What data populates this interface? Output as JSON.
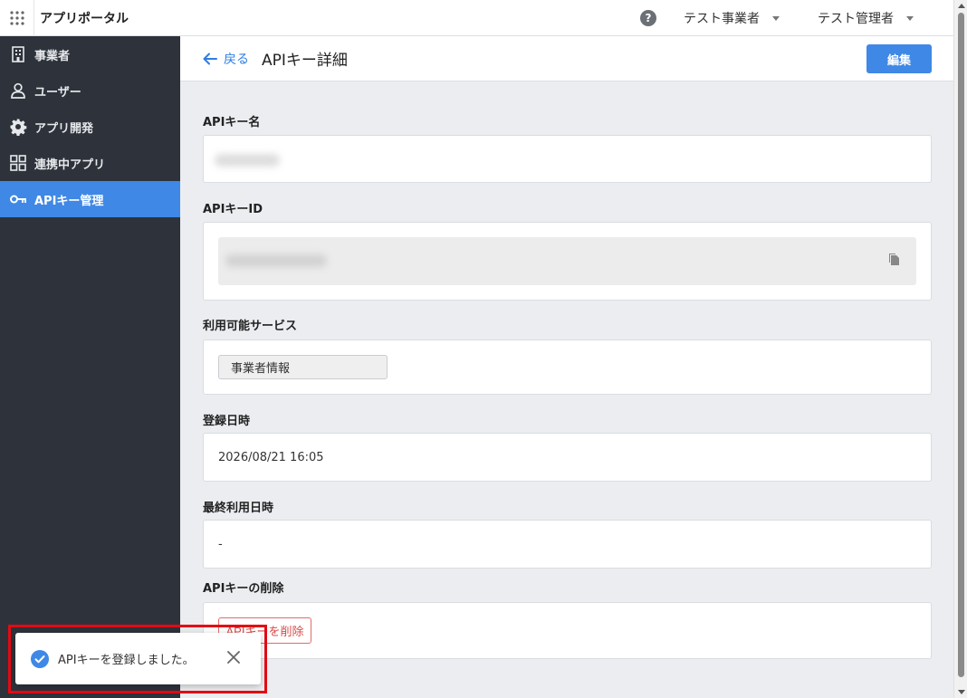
{
  "header": {
    "app_title": "アプリポータル",
    "help_icon": "help-icon",
    "business_menu": "テスト事業者",
    "user_menu": "テスト管理者"
  },
  "sidebar": {
    "items": [
      {
        "label": "事業者",
        "icon": "building-icon"
      },
      {
        "label": "ユーザー",
        "icon": "user-icon"
      },
      {
        "label": "アプリ開発",
        "icon": "gear-icon"
      },
      {
        "label": "連携中アプリ",
        "icon": "apps-icon"
      },
      {
        "label": "APIキー管理",
        "icon": "key-icon",
        "active": true
      }
    ]
  },
  "page": {
    "back_label": "戻る",
    "title": "APIキー詳細",
    "edit_label": "編集"
  },
  "fields": {
    "name_label": "APIキー名",
    "id_label": "APIキーID",
    "services_label": "利用可能サービス",
    "service_chip": "事業者情報",
    "registered_label": "登録日時",
    "registered_value": "2026/08/21 16:05",
    "last_used_label": "最終利用日時",
    "last_used_value": "-",
    "delete_section_label": "APIキーの削除",
    "delete_button": "APIキーを削除"
  },
  "toast": {
    "message": "APIキーを登録しました。"
  },
  "colors": {
    "accent": "#3f88e6",
    "sidebar_bg": "#2d323b",
    "danger": "#d94a4a",
    "highlight_frame": "#e50914"
  }
}
